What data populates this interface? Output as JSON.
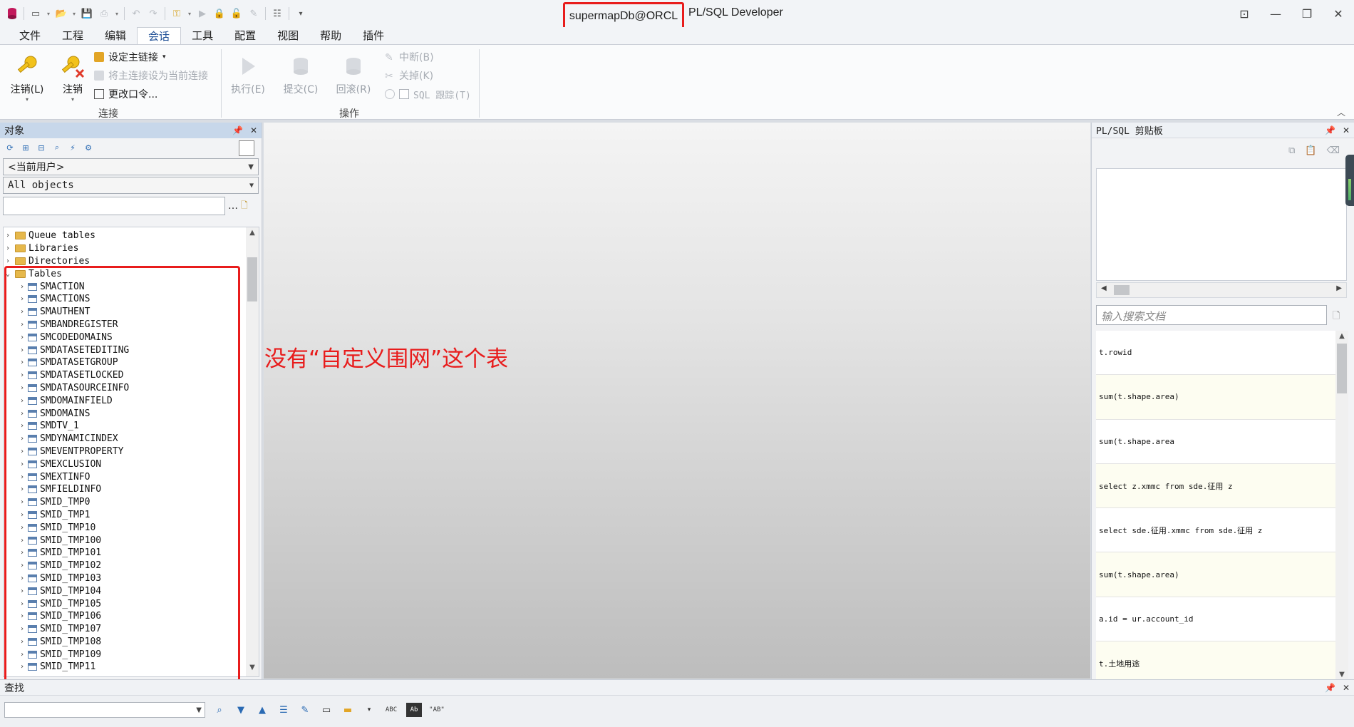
{
  "window": {
    "connection": "supermapDb@ORCL",
    "app_name": "PL/SQL Developer"
  },
  "menu": [
    "文件",
    "工程",
    "编辑",
    "会话",
    "工具",
    "配置",
    "视图",
    "帮助",
    "插件"
  ],
  "menu_active_index": 3,
  "ribbon": {
    "logoff_label": "注销(L)",
    "logout_label": "注销",
    "set_main_connection": "设定主链接",
    "set_as_current": "将主连接设为当前连接",
    "change_password": "更改口令...",
    "group_connection": "连接",
    "execute": "执行(E)",
    "commit": "提交(C)",
    "rollback": "回滚(R)",
    "break": "中断(B)",
    "close": "关掉(K)",
    "sql_trace": "SQL 跟踪(T)",
    "group_operation": "操作"
  },
  "object_panel": {
    "title": "对象",
    "owner_combo": "<当前用户>",
    "type_combo": "All objects",
    "filter_value": "",
    "folders": [
      "Queue tables",
      "Libraries",
      "Directories"
    ],
    "tables_folder": "Tables",
    "tables": [
      "SMACTION",
      "SMACTIONS",
      "SMAUTHENT",
      "SMBANDREGISTER",
      "SMCODEDOMAINS",
      "SMDATASETEDITING",
      "SMDATASETGROUP",
      "SMDATASETLOCKED",
      "SMDATASOURCEINFO",
      "SMDOMAINFIELD",
      "SMDOMAINS",
      "SMDTV_1",
      "SMDYNAMICINDEX",
      "SMEVENTPROPERTY",
      "SMEXCLUSION",
      "SMEXTINFO",
      "SMFIELDINFO",
      "SMID_TMP0",
      "SMID_TMP1",
      "SMID_TMP10",
      "SMID_TMP100",
      "SMID_TMP101",
      "SMID_TMP102",
      "SMID_TMP103",
      "SMID_TMP104",
      "SMID_TMP105",
      "SMID_TMP106",
      "SMID_TMP107",
      "SMID_TMP108",
      "SMID_TMP109",
      "SMID_TMP11"
    ]
  },
  "annotation": "没有“自定义围网”这个表",
  "clipboard_panel": {
    "title": "PL/SQL 剪贴板",
    "search_placeholder": "输入搜索文档",
    "items": [
      "t.rowid",
      "sum(t.shape.area)",
      "sum(t.shape.area",
      "select z.xmmc from sde.征用 z",
      "select sde.征用.xmmc from sde.征用 z",
      "sum(t.shape.area)",
      "a.id = ur.account_id",
      "t.土地用途"
    ]
  },
  "find_bar": {
    "title": "查找",
    "input_value": ""
  },
  "colors": {
    "highlight": "#e81c1c",
    "panel_header": "#c7d7ea",
    "accent": "#1f4f96"
  }
}
